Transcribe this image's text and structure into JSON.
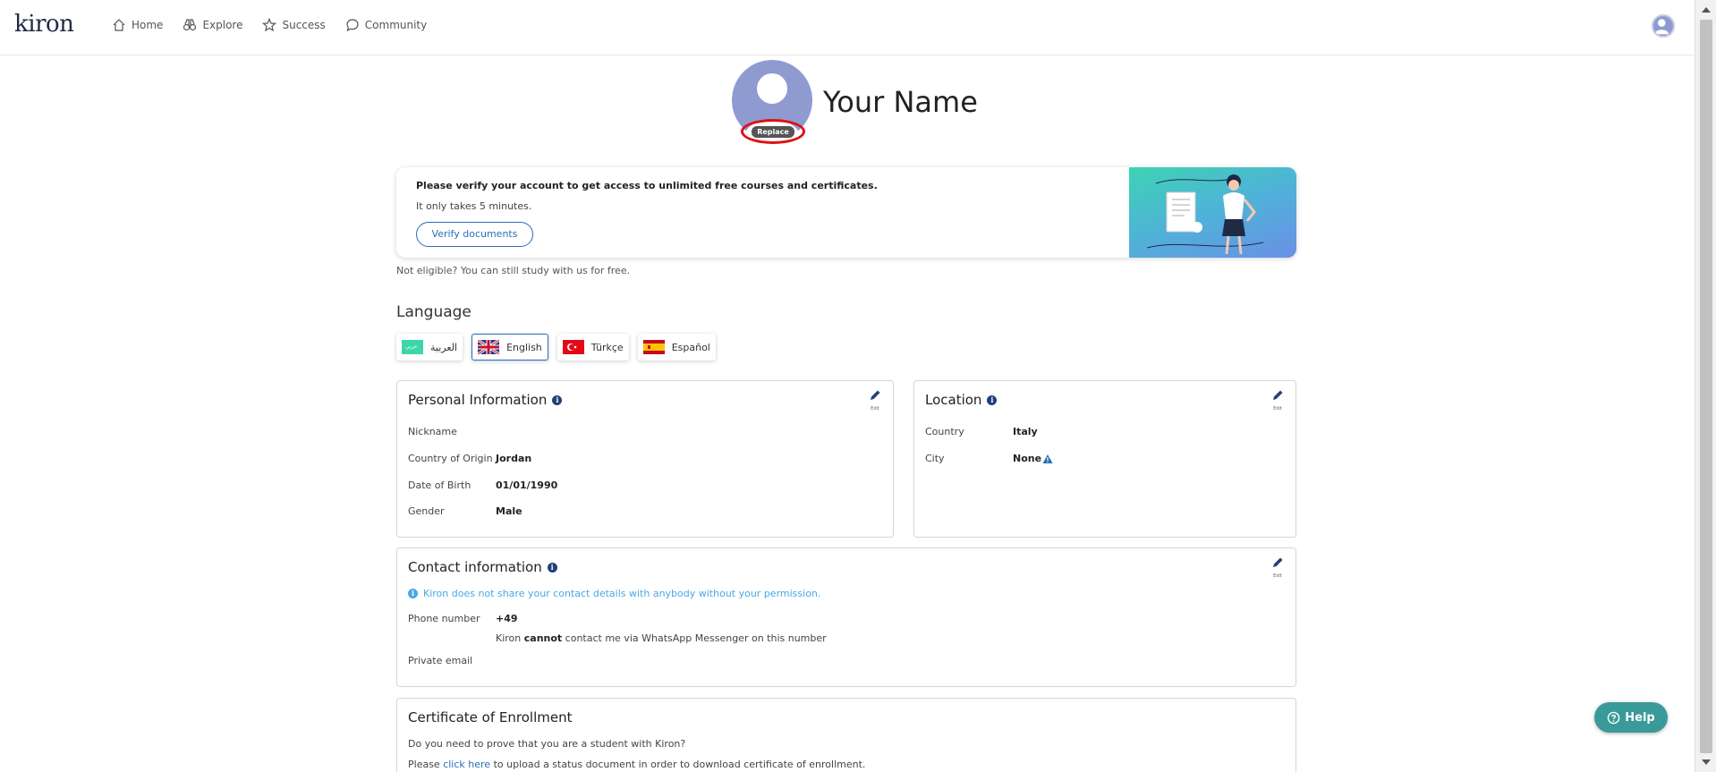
{
  "app": {
    "logo": "kiron"
  },
  "nav": {
    "home": "Home",
    "explore": "Explore",
    "success": "Success",
    "community": "Community"
  },
  "profile": {
    "name": "Your Name",
    "replace_label": "Replace"
  },
  "banner": {
    "title": "Please verify your account to get access to unlimited free courses and certificates.",
    "subtitle": "It only takes 5 minutes.",
    "verify_button": "Verify documents"
  },
  "not_eligible": "Not eligible? You can still study with us for free.",
  "language": {
    "title": "Language",
    "options": [
      {
        "label": "العربية",
        "flag": "arabic",
        "active": false
      },
      {
        "label": "English",
        "flag": "uk",
        "active": true
      },
      {
        "label": "Türkçe",
        "flag": "turkey",
        "active": false
      },
      {
        "label": "Español",
        "flag": "spain",
        "active": false
      }
    ]
  },
  "personal": {
    "title": "Personal Information",
    "edit_label": "Edit",
    "nickname_label": "Nickname",
    "nickname_value": "",
    "origin_label": "Country of Origin",
    "origin_value": "Jordan",
    "dob_label": "Date of Birth",
    "dob_value": "01/01/1990",
    "gender_label": "Gender",
    "gender_value": "Male"
  },
  "location": {
    "title": "Location",
    "edit_label": "Edit",
    "country_label": "Country",
    "country_value": "Italy",
    "city_label": "City",
    "city_value": "None"
  },
  "contact": {
    "title": "Contact information",
    "edit_label": "Edit",
    "notice": "Kiron does not share your contact details with anybody without your permission.",
    "phone_label": "Phone number",
    "phone_value": "+49",
    "whatsapp_pre": "Kiron ",
    "whatsapp_bold": "cannot",
    "whatsapp_post": " contact me via WhatsApp Messenger on this number",
    "email_label": "Private email",
    "email_value": ""
  },
  "certificate": {
    "title": "Certificate of Enrollment",
    "question": "Do you need to prove that you are a student with Kiron?",
    "line_pre": "Please ",
    "link": "click here",
    "line_post": " to upload a status document in order to download certificate of enrollment."
  },
  "help": {
    "label": "Help"
  },
  "colors": {
    "accent": "#2a6fb5",
    "help": "#3a9a9a",
    "notice": "#4aa8e6",
    "replace_ring": "#dd1111"
  }
}
